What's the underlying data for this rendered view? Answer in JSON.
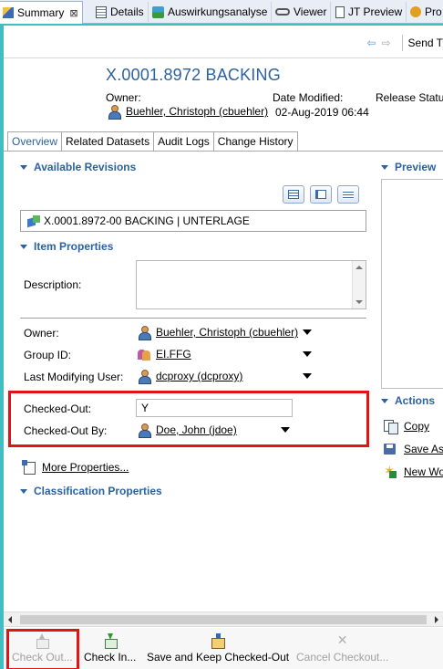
{
  "tabs": [
    {
      "label": "Summary",
      "icon": "summary-icon",
      "active": true,
      "close": "⊠"
    },
    {
      "label": "Details",
      "icon": "details-icon"
    },
    {
      "label": "Auswirkungsanalyse",
      "icon": "impact-analysis-icon"
    },
    {
      "label": "Viewer",
      "icon": "viewer-icon"
    },
    {
      "label": "JT Preview",
      "icon": "jt-preview-icon"
    },
    {
      "label": "Pro",
      "icon": "properties-icon"
    }
  ],
  "toolbar": {
    "send_label": "Send T"
  },
  "header": {
    "title": "X.0001.8972 BACKING",
    "owner_label": "Owner:",
    "date_modified_label": "Date Modified:",
    "release_status_label": "Release Status",
    "owner_value": "Buehler, Christoph (cbuehler)",
    "date_modified_value": "02-Aug-2019 06:44"
  },
  "subtabs": [
    "Overview",
    "Related Datasets",
    "Audit Logs",
    "Change History"
  ],
  "sections": {
    "available_revisions": "Available Revisions",
    "item_properties": "Item Properties",
    "classification_properties": "Classification Properties",
    "preview": "Preview",
    "actions": "Actions"
  },
  "revision": {
    "label": "X.0001.8972-00 BACKING | UNTERLAGE"
  },
  "properties": {
    "description_label": "Description:",
    "description_value": "",
    "owner_label": "Owner:",
    "owner_value": "Buehler, Christoph (cbuehler)",
    "group_label": "Group ID:",
    "group_value": "EI.FFG",
    "last_mod_label": "Last Modifying User:",
    "last_mod_value": "dcproxy (dcproxy)",
    "checked_out_label": "Checked-Out:",
    "checked_out_value": "Y",
    "checked_out_by_label": "Checked-Out By:",
    "checked_out_by_value": "Doe, John (jdoe)",
    "more_properties": "More Properties..."
  },
  "actions": {
    "copy": "Copy",
    "save_as": "Save As",
    "new_workflow": "New Wo"
  },
  "bottom_buttons": {
    "check_out": "Check Out...",
    "check_in": "Check In...",
    "save_keep": "Save and Keep Checked-Out",
    "cancel_checkout": "Cancel Checkout..."
  },
  "colors": {
    "accent_blue": "#2b62a0",
    "frame_teal": "#3fbfbf",
    "highlight_red": "#e01414"
  }
}
